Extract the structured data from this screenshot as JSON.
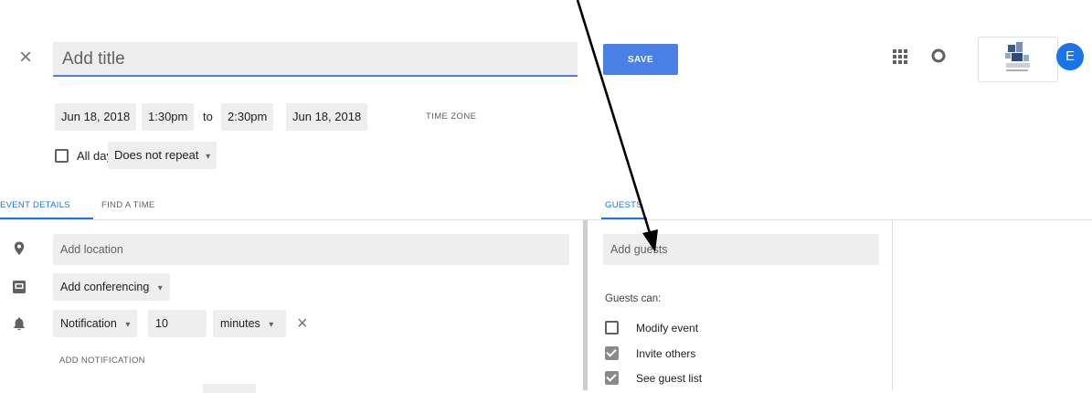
{
  "header": {
    "close_glyph": "×",
    "title_placeholder": "Add title",
    "save_label": "SAVE",
    "avatar_initial": "E"
  },
  "datetime": {
    "start_date": "Jun 18, 2018",
    "start_time": "1:30pm",
    "to_label": "to",
    "end_time": "2:30pm",
    "end_date": "Jun 18, 2018",
    "timezone_label": "TIME ZONE",
    "all_day_label": "All day",
    "all_day_checked": false,
    "repeat_value": "Does not repeat",
    "dropdown_glyph": "▾"
  },
  "tabs": {
    "event_details": "EVENT DETAILS",
    "find_a_time": "FIND A TIME",
    "guests": "GUESTS"
  },
  "details": {
    "location_placeholder": "Add location",
    "conferencing_label": "Add conferencing",
    "notification": {
      "type": "Notification",
      "value": "10",
      "unit": "minutes",
      "remove_glyph": "×"
    },
    "add_notification_label": "ADD NOTIFICATION"
  },
  "guests": {
    "add_placeholder": "Add guests",
    "can_label": "Guests can:",
    "permissions": [
      {
        "label": "Modify event",
        "checked": false
      },
      {
        "label": "Invite others",
        "checked": true
      },
      {
        "label": "See guest list",
        "checked": true
      }
    ]
  },
  "icons": {
    "close": "close-icon",
    "apps": "apps-grid-icon",
    "notifications": "notification-ring-icon",
    "location": "location-pin-icon",
    "conferencing": "conference-icon",
    "bell": "bell-icon"
  },
  "colors": {
    "accent": "#4a80e6",
    "tab_active": "#1a73e8",
    "avatar": "#1a73e8",
    "field_bg": "#eeeeee",
    "annotation_arrow": "#000000"
  }
}
